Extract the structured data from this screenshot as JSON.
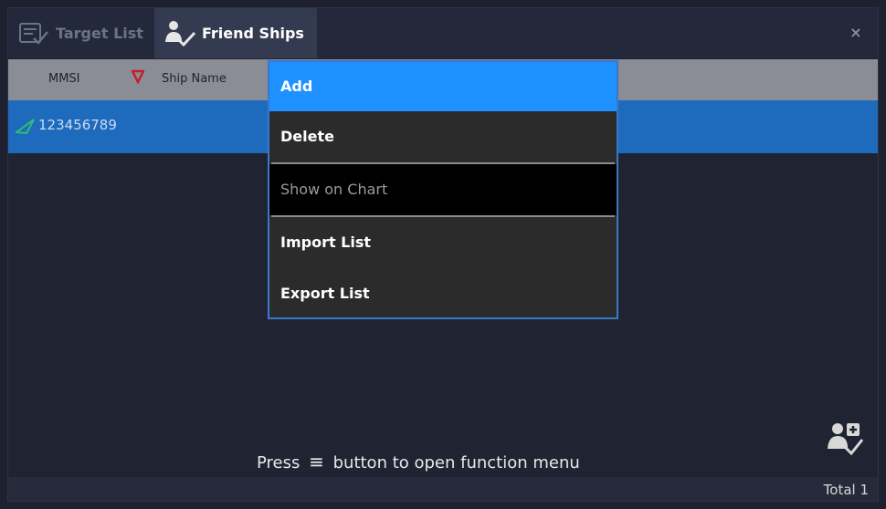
{
  "tabs": [
    {
      "label": "Target List",
      "icon": "target-list-icon"
    },
    {
      "label": "Friend Ships",
      "icon": "friend-ships-icon"
    }
  ],
  "close_label": "×",
  "table": {
    "columns": [
      "MMSI",
      "Ship Name"
    ],
    "rows": [
      {
        "mmsi": "123456789",
        "ship_name": ""
      }
    ]
  },
  "menu": {
    "items": [
      {
        "label": "Add",
        "state": "highlighted"
      },
      {
        "label": "Delete",
        "state": "normal"
      },
      {
        "label": "Show on Chart",
        "state": "disabled"
      },
      {
        "label": "Import List",
        "state": "normal"
      },
      {
        "label": "Export List",
        "state": "normal"
      }
    ]
  },
  "hint": {
    "before": "Press",
    "glyph": "≡",
    "after": "button to open function menu"
  },
  "footer": {
    "total": "Total 1"
  },
  "colors": {
    "accent": "#1e90ff",
    "selected_row": "#1e6bbd",
    "friend_ship_icon": "#2fbf71"
  }
}
